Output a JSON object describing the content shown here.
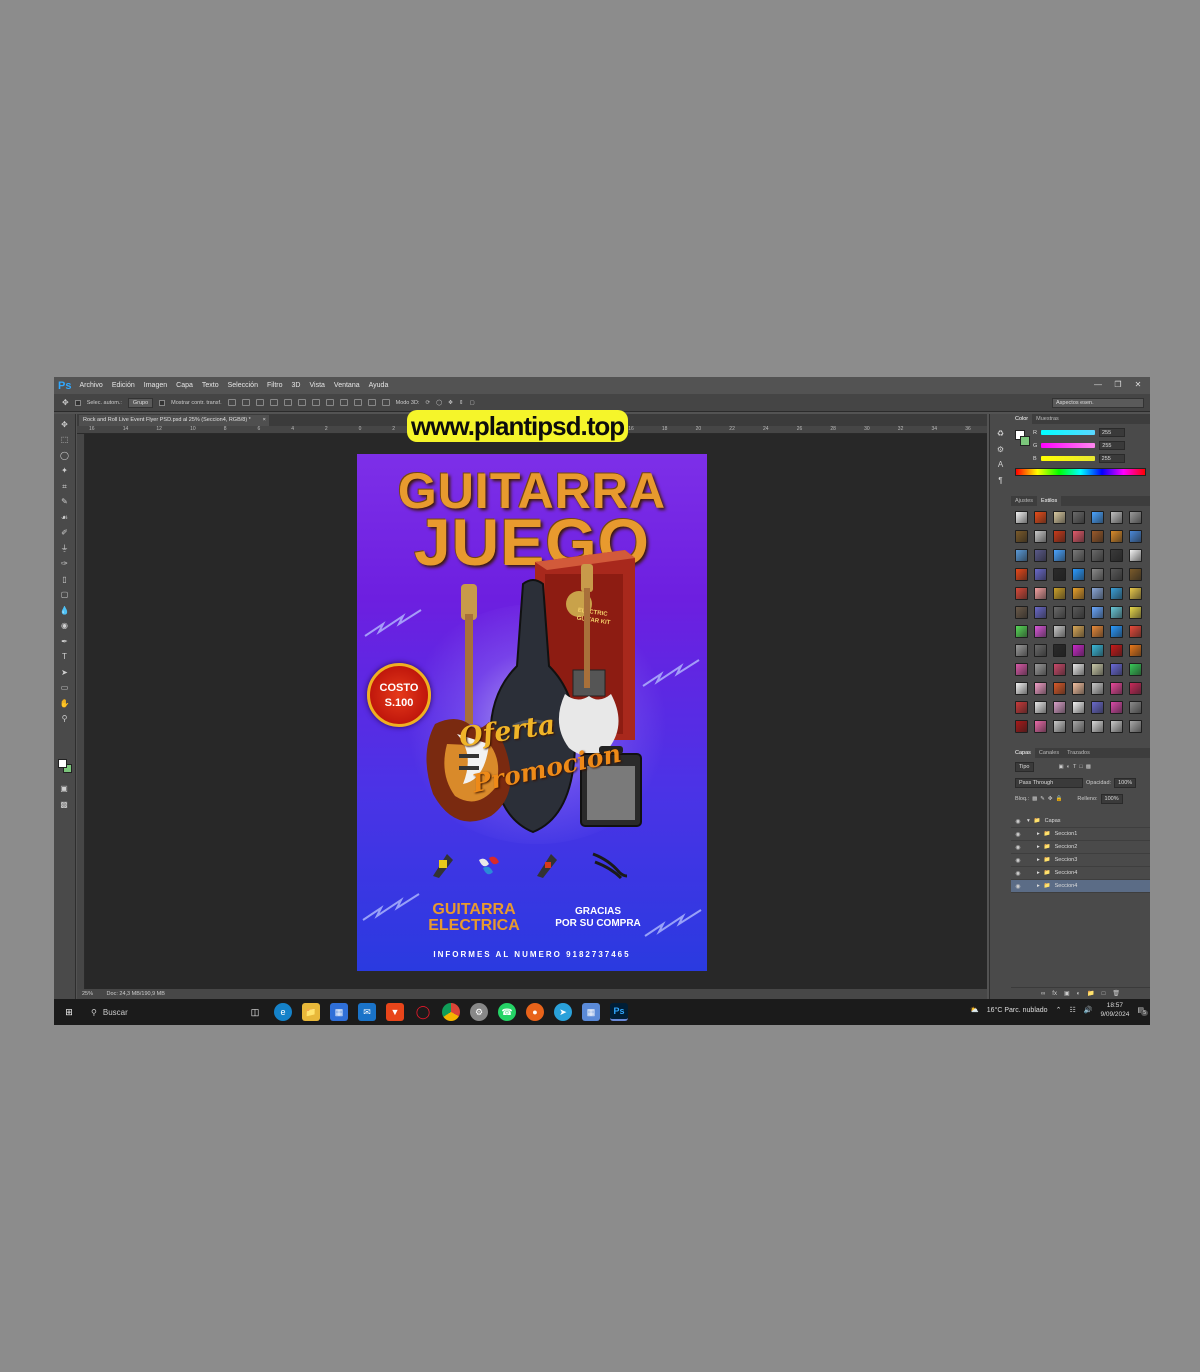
{
  "watermark": "www.plantipsd.top",
  "app": {
    "logo": "Ps",
    "menu": [
      "Archivo",
      "Edición",
      "Imagen",
      "Capa",
      "Texto",
      "Selección",
      "Filtro",
      "3D",
      "Vista",
      "Ventana",
      "Ayuda"
    ],
    "window_controls": [
      "minimize-icon",
      "restore-icon",
      "close-icon"
    ]
  },
  "options_bar": {
    "auto_select_label": "Selec. autom.:",
    "auto_select_value": "Grupo",
    "show_transform_label": "Mostrar contr. transf.",
    "mode_label": "Modo 3D:",
    "workspace": "Aspectos esen."
  },
  "document": {
    "tab_title": "Rock and Roll Live Event Flyer PSD.psd al 25% (Seccion4, RGB/8) *",
    "ruler_labels": [
      "16",
      "14",
      "12",
      "10",
      "8",
      "6",
      "4",
      "2",
      "0",
      "2",
      "4",
      "6",
      "8",
      "10",
      "12",
      "14",
      "16",
      "18",
      "20",
      "22",
      "24",
      "26",
      "28",
      "30",
      "32",
      "34",
      "36"
    ]
  },
  "status": {
    "zoom": "25%",
    "doc_size": "Doc: 24,3 MB/190,9 MB"
  },
  "flyer": {
    "title_line1": "GUITARRA",
    "title_line2": "JUEGO",
    "costo_line1": "COSTO",
    "costo_line2": "S.100",
    "oferta": "Oferta",
    "promocion": "Promocion",
    "guitarra_line1": "GUITARRA",
    "guitarra_line2": "ELECTRICA",
    "gracias_line1": "GRACIAS",
    "gracias_line2": "POR SU COMPRA",
    "informes": "INFORMES AL NUMERO 9182737465",
    "box_label_line1": "ELECTRIC",
    "box_label_line2": "GUITAR KIT"
  },
  "color_panel": {
    "tabs": [
      "Color",
      "Muestras"
    ],
    "channels": [
      {
        "label": "R",
        "value": "255",
        "color": "#5bd7ff"
      },
      {
        "label": "G",
        "value": "255",
        "color": "#ff55dd"
      },
      {
        "label": "B",
        "value": "255",
        "color": "#e8e832"
      }
    ]
  },
  "styles_panel": {
    "tabs": [
      "Ajustes",
      "Estilos"
    ],
    "swatches": [
      "#f2f2f2",
      "#e84d1a",
      "#d7c8a0",
      "#6a6a6a",
      "#4aa4ff",
      "#bfbfbf",
      "#9a9a9a",
      "#7a5a2a",
      "#c8c8c8",
      "#c83a1a",
      "#e05a6a",
      "#9a5a2a",
      "#d88a2a",
      "#4a88d8",
      "#5a9ad8",
      "#5a5a8a",
      "#4aa4ff",
      "#7a7a7a",
      "#6a6a6a",
      "#3a3a3a",
      "#f2f2f2",
      "#e8481a",
      "#6a6aca",
      "#2a2a2a",
      "#2a9aff",
      "#8a8a8a",
      "#5a5a5a",
      "#7a5a2a",
      "#d84a3a",
      "#f2a0a0",
      "#caa02a",
      "#e8a02a",
      "#8aa8d8",
      "#3aa0d8",
      "#e8c84a",
      "#6a5a4a",
      "#6a6ac8",
      "#6a6a6a",
      "#5a5a5a",
      "#6aa8ff",
      "#6ac8d8",
      "#e8d84a",
      "#58d858",
      "#d858d8",
      "#c8c8c8",
      "#d8a858",
      "#e88a3a",
      "#2a9aff",
      "#e84a3a",
      "#9a9a9a",
      "#6a6a6a",
      "#2a2a2a",
      "#c82ac8",
      "#3ab8d8",
      "#c81a1a",
      "#e8781a",
      "#d85aa8",
      "#9a9a9a",
      "#c84a6a",
      "#e8e8e8",
      "#c8c8a8",
      "#6a6ad8",
      "#38c858",
      "#f2f2f2",
      "#f2a0c8",
      "#d85a2a",
      "#f2c0a0",
      "#c8c8c8",
      "#e8489a",
      "#c82a5a",
      "#c83a3a",
      "#e8e8e8",
      "#d8a0c8",
      "#f2f2f2",
      "#6a6aca",
      "#d84aa8",
      "#8a8a8a",
      "#a81a1a",
      "#e86aa8",
      "#c8c8c8",
      "#a8a8a8",
      "#d8d8d8",
      "#c8c8c8",
      "#a8a8a8"
    ]
  },
  "layers_panel": {
    "tabs": [
      "Capas",
      "Canales",
      "Trazados"
    ],
    "kind_filter": "Tipo",
    "blend_mode": "Pass Through",
    "opacity_label": "Opacidad:",
    "opacity_value": "100%",
    "lock_label": "Bloq.:",
    "fill_label": "Relleno:",
    "fill_value": "100%",
    "group_name": "Capas",
    "layers": [
      "Seccion1",
      "Seccion2",
      "Seccion3",
      "Seccion4",
      "Seccion4"
    ]
  },
  "taskbar": {
    "search_placeholder": "Buscar",
    "weather": "16°C  Parc. nublado",
    "time": "18:57",
    "date": "9/09/2024",
    "notification_count": "5",
    "app_icons": [
      "task-view-icon",
      "edge-icon",
      "file-explorer-icon",
      "store-icon",
      "mail-icon",
      "brave-icon",
      "opera-icon",
      "chrome-icon",
      "app-icon",
      "whatsapp-icon",
      "firefox-icon",
      "telegram-icon",
      "app-icon-2",
      "photoshop-icon"
    ]
  }
}
